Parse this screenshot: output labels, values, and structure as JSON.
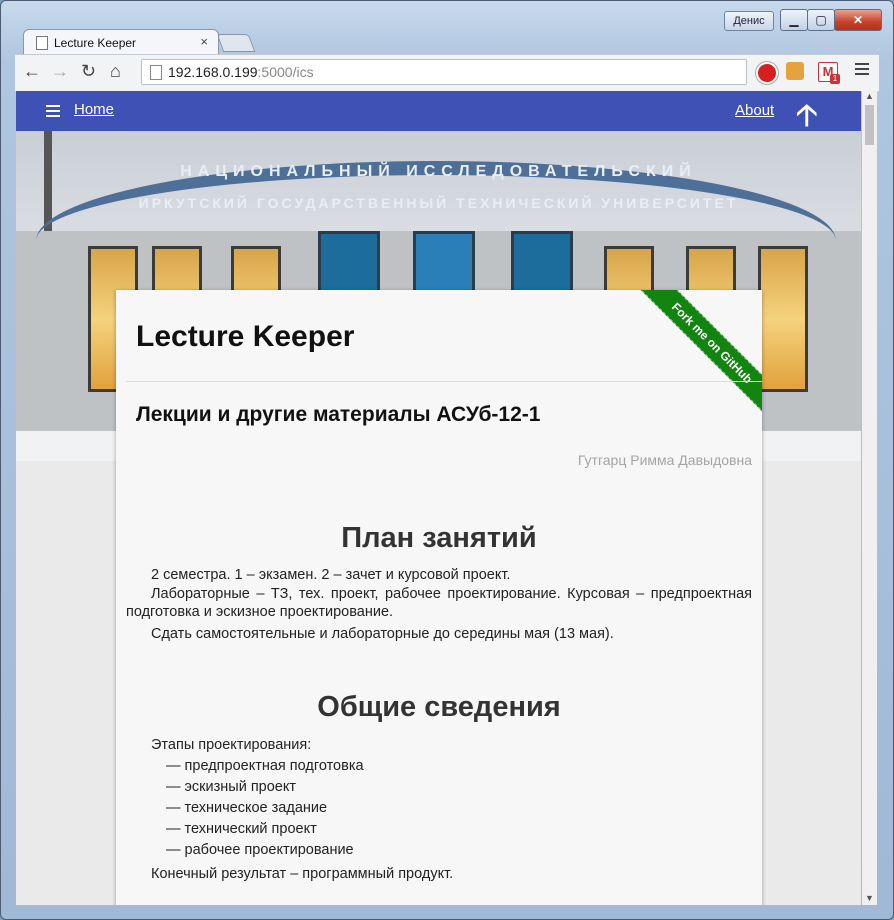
{
  "window": {
    "user_button": "Денис",
    "minimize": "▁",
    "maximize": "▢",
    "close": "✕"
  },
  "tab": {
    "title": "Lecture Keeper",
    "close": "×"
  },
  "toolbar": {
    "back": "←",
    "forward": "→",
    "reload": "↻",
    "home": "⌂",
    "url_host": "192.168.0.199",
    "url_port_path": ":5000/ics",
    "gmail_badge": "1"
  },
  "appbar": {
    "menu_icon": "hamburger-icon",
    "home_label": "Home",
    "about_label": "About",
    "up_arrow": "🡡"
  },
  "hero": {
    "arch_text_1": "НАЦИОНАЛЬНЫЙ ИССЛЕДОВАТЕЛЬСКИЙ",
    "arch_text_2": "ИРКУТСКИЙ ГОСУДАРСТВЕННЫЙ ТЕХНИЧЕСКИЙ УНИВЕРСИТЕТ"
  },
  "card": {
    "site_title": "Lecture Keeper",
    "course_title": "Лекции и другие материалы АСУб-12-1",
    "author": "Гутгарц Римма Давыдовна",
    "ribbon": "Fork me on GitHub"
  },
  "plan": {
    "heading": "План занятий",
    "p1": "2 семестра. 1 – экзамен. 2 – зачет и курсовой проект.",
    "p2": "Лабораторные – ТЗ, тех. проект, рабочее проектирование. Курсовая – предпроектная подготовка и эскизное проектирование.",
    "p3": "Сдать самостоятельные и лабораторные до середины мая (13 мая)."
  },
  "general": {
    "heading": "Общие сведения",
    "intro": "Этапы проектирования:",
    "items": [
      "— предпроектная подготовка",
      "— эскизный проект",
      "— техническое задание",
      "— технический проект",
      "— рабочее проектирование"
    ],
    "result": "Конечный результат – программный продукт."
  },
  "colors": {
    "appbar": "#3f51b5",
    "ribbon": "#11850f",
    "author": "#a4a4a4"
  }
}
